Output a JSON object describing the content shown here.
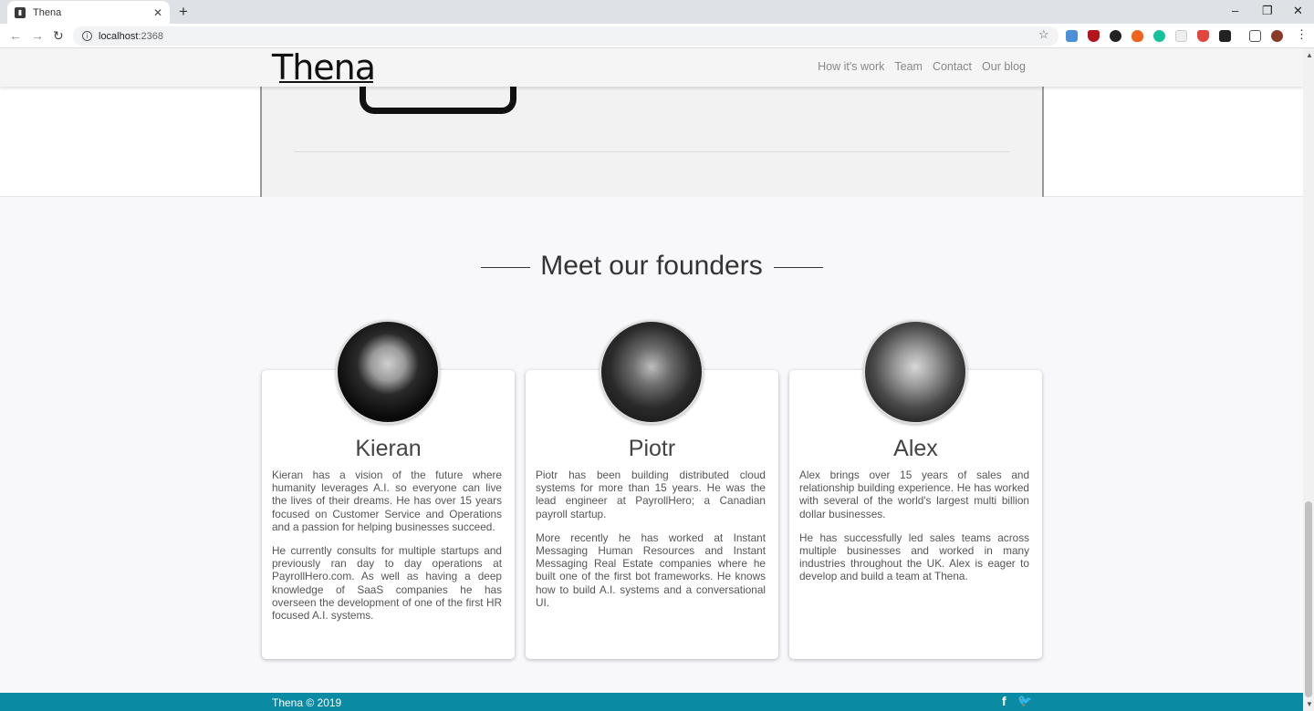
{
  "browser": {
    "tab_title": "Thena",
    "tab_close": "✕",
    "new_tab": "+",
    "url_host": "localhost",
    "url_port": ":2368",
    "minimize": "–",
    "restore": "❐",
    "close": "✕"
  },
  "nav": {
    "logo": "Thena",
    "links": [
      "How it's work",
      "Team",
      "Contact",
      "Our blog"
    ]
  },
  "founders": {
    "heading": "Meet our founders",
    "people": [
      {
        "name": "Kieran",
        "paragraphs": [
          "Kieran has a vision of the future where humanity leverages A.I. so everyone can live the lives of their dreams. He has over 15 years focused on Customer Service and Operations and a passion for helping businesses succeed.",
          "He currently consults for multiple startups and previously ran day to day operations at PayrollHero.com. As well as having a deep knowledge of SaaS companies he has overseen the development of one of the first HR focused A.I. systems."
        ]
      },
      {
        "name": "Piotr",
        "paragraphs": [
          "Piotr has been building distributed cloud systems for more than 15 years. He was the lead engineer at PayrollHero; a Canadian payroll startup.",
          "More recently he has worked at Instant Messaging Human Resources and Instant Messaging Real Estate companies where he built one of the first bot frameworks. He knows how to build A.I. systems and a conversational UI."
        ]
      },
      {
        "name": "Alex",
        "paragraphs": [
          "Alex brings over 15 years of sales and relationship building experience. He has worked with several of the world's largest multi billion dollar businesses.",
          "He has successfully led sales teams across multiple businesses and worked in many industries throughout the UK. Alex is eager to develop and build a team at Thena."
        ]
      }
    ]
  },
  "footer": {
    "copyright": "Thena © 2019",
    "social": [
      "facebook-icon",
      "twitter-icon"
    ]
  },
  "colors": {
    "footer_bg": "#0a8ba3",
    "page_bg": "#f8f8fb"
  }
}
